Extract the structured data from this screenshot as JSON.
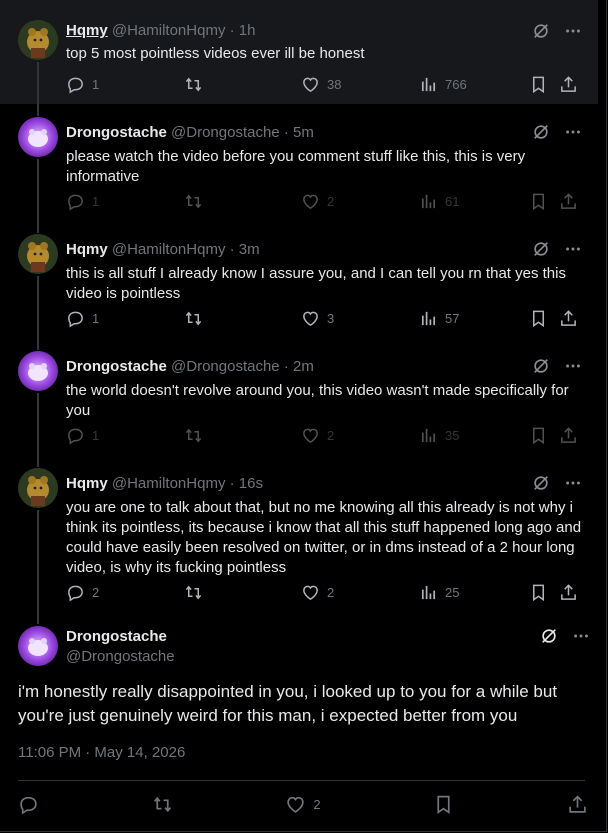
{
  "replies": [
    {
      "name": "Hqmy",
      "handle": "@HamiltonHqmy",
      "time": "· 1h",
      "text": "top 5 most pointless videos ever ill be honest",
      "replies": "1",
      "reposts": "",
      "likes": "38",
      "views": "766"
    },
    {
      "name": "Drongostache",
      "handle": "@Drongostache",
      "time": "· 5m",
      "text": "please watch the video before you comment stuff like this, this is very informative",
      "replies": "1",
      "reposts": "",
      "likes": "2",
      "views": "61"
    },
    {
      "name": "Hqmy",
      "handle": "@HamiltonHqmy",
      "time": "· 3m",
      "text": "this is all stuff I already know I assure you, and I can tell you rn that yes this video is pointless",
      "replies": "1",
      "reposts": "",
      "likes": "3",
      "views": "57"
    },
    {
      "name": "Drongostache",
      "handle": "@Drongostache",
      "time": "· 2m",
      "text": "the world doesn't revolve around you, this video wasn't made specifically for you",
      "replies": "1",
      "reposts": "",
      "likes": "2",
      "views": "35"
    },
    {
      "name": "Hqmy",
      "handle": "@HamiltonHqmy",
      "time": "· 16s",
      "text": "you are one to talk about that, but no me knowing all this already is not why i think its pointless, its because i know that all this stuff happened long ago and could have easily been resolved on twitter, or in dms instead of a 2 hour long video, is why its fucking pointless",
      "replies": "2",
      "reposts": "",
      "likes": "2",
      "views": "25"
    }
  ],
  "main": {
    "name": "Drongostache",
    "handle": "@Drongostache",
    "text": "i'm honestly really disappointed in you, i looked up to you for a while but you're just genuinely weird for this man, i expected better from you",
    "timestamp": "11:06 PM · May 14, 2026",
    "likes": "2"
  },
  "colors": {
    "background": "#000000",
    "text": "#e7e9ea",
    "muted": "#71767b",
    "border": "#2f3336",
    "highlight": "#16181c"
  }
}
